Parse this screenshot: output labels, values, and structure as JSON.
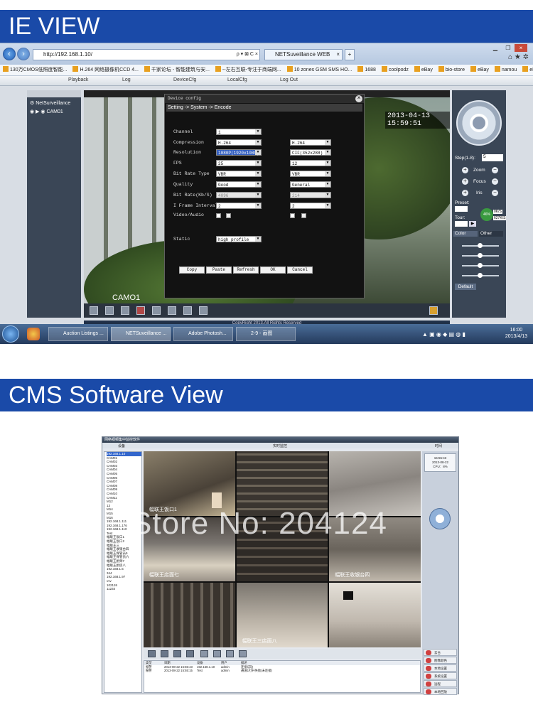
{
  "sections": {
    "ie_title": "IE VIEW",
    "cms_title": "CMS Software View"
  },
  "browser": {
    "address": "http://192.168.1.10/",
    "tab_title": "NETSuveillance WEB",
    "search_glyph": "ρ ▾ ⊠ C ×",
    "home_glyph": "⌂ ★ ✲",
    "favorites": [
      "130万CMOS低照度智能...",
      "H.264 网络摄像机CCD 4...",
      "千家论坛 - 智能建筑与安...",
      "--左右互联-专注于商端网...",
      "10 zones GSM SMS HO...",
      "1688",
      "coolpodz",
      "eBay",
      "bio-store",
      "eBay",
      "namou",
      "eBay"
    ]
  },
  "menu": {
    "playback": "Playback",
    "log": "Log",
    "devicecfg": "DeviceCfg",
    "localcfg": "LocalCfg",
    "logout": "Log Out"
  },
  "device_tree": {
    "root": "NetSurveillance",
    "cam": "CAM01"
  },
  "video": {
    "timestamp": "2013-04-13  15:59:51",
    "cam_label": "CAMO1"
  },
  "dialog": {
    "title": "Device config",
    "breadcrumb": "Setting -> System -> Encode",
    "labels": {
      "channel": "Channel",
      "compression": "Compression",
      "resolution": "Resolution",
      "fps": "FPS",
      "bitrate_type": "Bit Rate Type",
      "quality": "Quality",
      "bitrate": "Bit Rate(Kb/S)",
      "iframe": "I Frame Interval",
      "video_audio": "Video/Audio",
      "static": "Static"
    },
    "main": {
      "channel": "1",
      "compression": "H.264",
      "resolution": "1080P(1920x1080)",
      "fps": "25",
      "bitrate_type": "VBR",
      "quality": "Good",
      "bitrate": "4096",
      "iframe": "2"
    },
    "extra": {
      "compression": "H.264",
      "resolution": "CIF(352x288)",
      "fps": "12",
      "bitrate_type": "VBR",
      "quality": "General",
      "bitrate": "214",
      "iframe": "2"
    },
    "static": "high profile",
    "buttons": {
      "copy": "Copy",
      "paste": "Paste",
      "refresh": "Refresh",
      "ok": "OK",
      "cancel": "Cancel"
    }
  },
  "ptz_panel": {
    "step_label": "Step(1-8):",
    "step_value": "5",
    "zoom": "Zoom",
    "focus": "Focus",
    "iris": "Iris",
    "preset": "Preset:",
    "tour": "Tour:",
    "net_up": "0K/S",
    "net_down": "627K/S",
    "net_pct": "46%",
    "tab_color": "Color",
    "tab_other": "Other",
    "default_btn": "Default"
  },
  "status": {
    "copyright": "CopyRight 2013,All Rights Reserved"
  },
  "taskbar": {
    "items": [
      "Auction Listings ...",
      "NETSuveillance ...",
      "Adobe Photosh...",
      "2-9 - 画图"
    ],
    "time": "16:00",
    "date": "2013/4/13"
  },
  "cms": {
    "window_title": "网络视频集中监控软件",
    "tab_device": "设备",
    "tab_live": "实时监控",
    "tab_time": "时间",
    "clock_time": "15:55:43",
    "clock_date": "2013-08-22",
    "cpu": "CPU：8%",
    "tree": [
      "192.168.1.10",
      "CAM01",
      "CAM02",
      "CAM03",
      "CAM04",
      "CAM05",
      "CAM06",
      "CAM07",
      "CAM08",
      "CAM09",
      "CAM10",
      "CAM11",
      "M12",
      "13",
      "M14",
      "M15",
      "M16",
      "192.168.1.111",
      "192.168.1.176",
      "192.168.1.110",
      "Test",
      "幅联王饭口1",
      "幅联王饭口2",
      "幅联王三",
      "幅联王收银台四",
      "幅联王保管员5",
      "幅联王保管员六",
      "幅联王厨师7",
      "幅联王厨房八",
      "192.168.1.5",
      "344",
      "192.168.1.97",
      "vvv",
      "102126",
      "11234"
    ],
    "cell_labels": [
      "幅联王饭口1",
      "",
      "",
      "幅联王店面七",
      "",
      "幅联王收银台四",
      "",
      "幅联王三店面八",
      ""
    ],
    "log_header": [
      "类型",
      "日期",
      "设备",
      "用户",
      "描述"
    ],
    "log_rows": [
      [
        "报警",
        "2013-08-22 15:55:43",
        "192.168.1.10",
        "admin",
        "连接成功"
      ],
      [
        "报警",
        "2013-08-22 15:55:15",
        "Test",
        "admin",
        "通道1打开失败(未连接)"
      ]
    ],
    "right_menu": [
      "云台",
      "图像颜色",
      "本地设置",
      "系统设置",
      "远程",
      "本地回放"
    ],
    "watermark": "Store No: 204124"
  }
}
